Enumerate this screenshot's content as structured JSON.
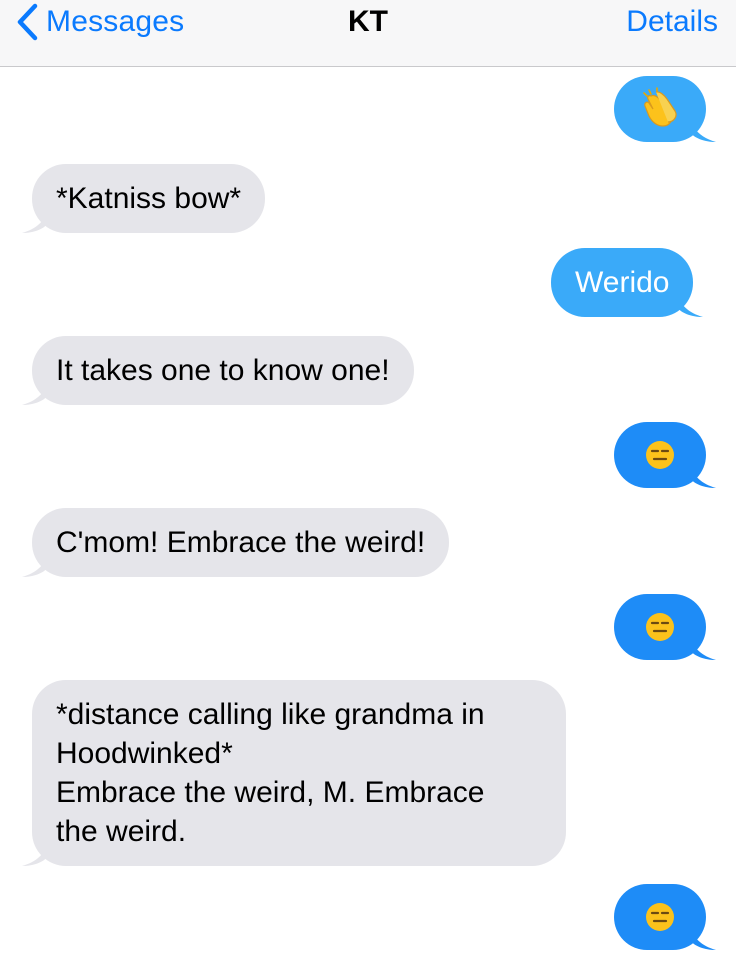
{
  "nav": {
    "back_label": "Messages",
    "title": "KT",
    "details_label": "Details"
  },
  "messages": [
    {
      "direction": "outgoing",
      "kind": "emoji",
      "emoji": "clapping-hands"
    },
    {
      "direction": "incoming",
      "text": "*Katniss bow*"
    },
    {
      "direction": "outgoing",
      "text": "Werido"
    },
    {
      "direction": "incoming",
      "text": "It takes one to know one!"
    },
    {
      "direction": "outgoing",
      "kind": "emoji",
      "emoji": "expressionless-face"
    },
    {
      "direction": "incoming",
      "text": "C'mom! Embrace the weird!"
    },
    {
      "direction": "outgoing",
      "kind": "emoji",
      "emoji": "expressionless-face"
    },
    {
      "direction": "incoming",
      "text": "*distance calling like grandma in\nHoodwinked*\nEmbrace the weird, M. Embrace\nthe weird."
    },
    {
      "direction": "outgoing",
      "kind": "emoji",
      "emoji": "expressionless-face"
    }
  ],
  "colors": {
    "accent": "#0a7afe",
    "incoming_bubble": "#e5e5ea",
    "outgoing_bubble": "#3aaaf9",
    "nav_background": "#f7f7f8"
  }
}
